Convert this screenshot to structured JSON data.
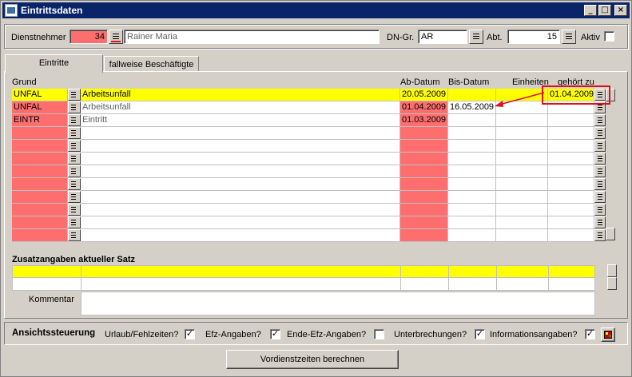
{
  "window": {
    "title": "Eintrittsdaten",
    "min": "_",
    "max": "□",
    "close": "×"
  },
  "header": {
    "dienstnehmer_label": "Dienstnehmer",
    "dienstnehmer_nr": "34",
    "dienstnehmer_name": "Rainer Maria",
    "dngr_label": "DN-Gr.",
    "dngr_value": "AR",
    "abt_label": "Abt.",
    "abt_value": "15",
    "aktiv_label": "Aktiv"
  },
  "tabs": [
    {
      "label": "Eintritte",
      "active": true
    },
    {
      "label": "fallweise Beschäftigte",
      "active": false
    }
  ],
  "grid": {
    "headers": {
      "grund": "Grund",
      "ab_datum": "Ab-Datum",
      "bis_datum": "Bis-Datum",
      "einheiten": "Einheiten",
      "gehoert_zu": "gehört zu"
    },
    "rows": [
      {
        "code": "UNFAL",
        "text": "Arbeitsunfall",
        "ab": "20.05.2009",
        "bis": "",
        "einheiten": "",
        "gehoert": "01.04.2009",
        "current": true
      },
      {
        "code": "UNFAL",
        "text": "Arbeitsunfall",
        "ab": "01.04.2009",
        "bis": "16.05.2009",
        "einheiten": "",
        "gehoert": "",
        "current": false
      },
      {
        "code": "EINTR",
        "text": "Eintritt",
        "ab": "01.03.2009",
        "bis": "",
        "einheiten": "",
        "gehoert": "",
        "current": false
      },
      {
        "code": "",
        "text": "",
        "ab": "",
        "bis": "",
        "einheiten": "",
        "gehoert": "",
        "current": false
      },
      {
        "code": "",
        "text": "",
        "ab": "",
        "bis": "",
        "einheiten": "",
        "gehoert": "",
        "current": false
      },
      {
        "code": "",
        "text": "",
        "ab": "",
        "bis": "",
        "einheiten": "",
        "gehoert": "",
        "current": false
      },
      {
        "code": "",
        "text": "",
        "ab": "",
        "bis": "",
        "einheiten": "",
        "gehoert": "",
        "current": false
      },
      {
        "code": "",
        "text": "",
        "ab": "",
        "bis": "",
        "einheiten": "",
        "gehoert": "",
        "current": false
      },
      {
        "code": "",
        "text": "",
        "ab": "",
        "bis": "",
        "einheiten": "",
        "gehoert": "",
        "current": false
      },
      {
        "code": "",
        "text": "",
        "ab": "",
        "bis": "",
        "einheiten": "",
        "gehoert": "",
        "current": false
      },
      {
        "code": "",
        "text": "",
        "ab": "",
        "bis": "",
        "einheiten": "",
        "gehoert": "",
        "current": false
      },
      {
        "code": "",
        "text": "",
        "ab": "",
        "bis": "",
        "einheiten": "",
        "gehoert": "",
        "current": false
      }
    ]
  },
  "zusatz": {
    "title": "Zusatzangaben aktueller Satz",
    "kommentar_label": "Kommentar"
  },
  "ansicht": {
    "title": "Ansichtssteuerung",
    "options": [
      {
        "label": "Urlaub/Fehlzeiten?",
        "checked": true
      },
      {
        "label": "Efz-Angaben?",
        "checked": true
      },
      {
        "label": "Ende-Efz-Angaben?",
        "checked": false
      },
      {
        "label": "Unterbrechungen?",
        "checked": true
      },
      {
        "label": "Informationsangaben?",
        "checked": true
      }
    ]
  },
  "actions": {
    "vordienstzeiten_label": "Vordienstzeiten berechnen"
  },
  "colors": {
    "required": "#ff6e6e",
    "current_row": "#ffff00",
    "highlight": "#e0101a",
    "titlebar": "#0a246a"
  }
}
